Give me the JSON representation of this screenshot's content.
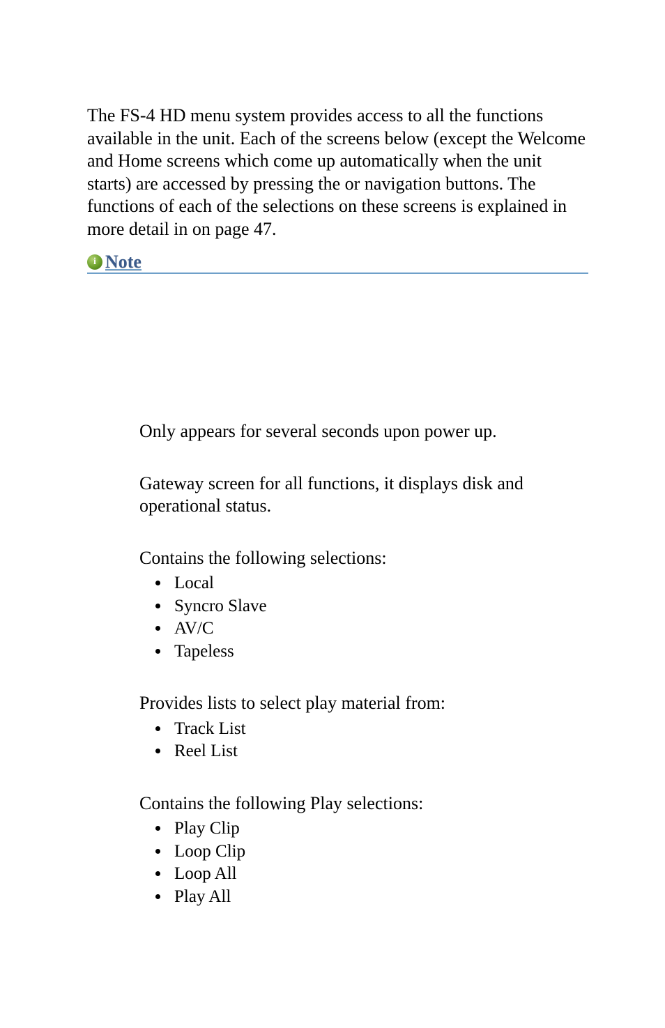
{
  "intro": {
    "t1": "The FS-4 HD menu system provides access to all the functions available in the unit. Each of the screens below (except the Welcome and Home screens which come up automatically when the unit starts) are accessed by pressing the ",
    "t2": " or ",
    "t3": " navigation buttons. The functions of each of the selections on these screens is explained in more detail in ",
    "t4": " on page 47."
  },
  "note": {
    "glyph": "i",
    "label": "Note"
  },
  "sections": {
    "welcome": {
      "desc": "Only appears for several seconds upon power up."
    },
    "home": {
      "desc": "Gateway screen for all functions, it displays disk and operational status."
    },
    "control": {
      "desc": "Contains the following selections:",
      "items": [
        "Local",
        "Syncro Slave",
        "AV/C",
        "Tapeless"
      ]
    },
    "playfrom": {
      "desc": "Provides lists to select play material from:",
      "items": [
        "Track List",
        "Reel List"
      ]
    },
    "play": {
      "desc": "Contains the following Play selections:",
      "items": [
        "Play Clip",
        "Loop Clip",
        "Loop All",
        "Play All"
      ]
    }
  }
}
